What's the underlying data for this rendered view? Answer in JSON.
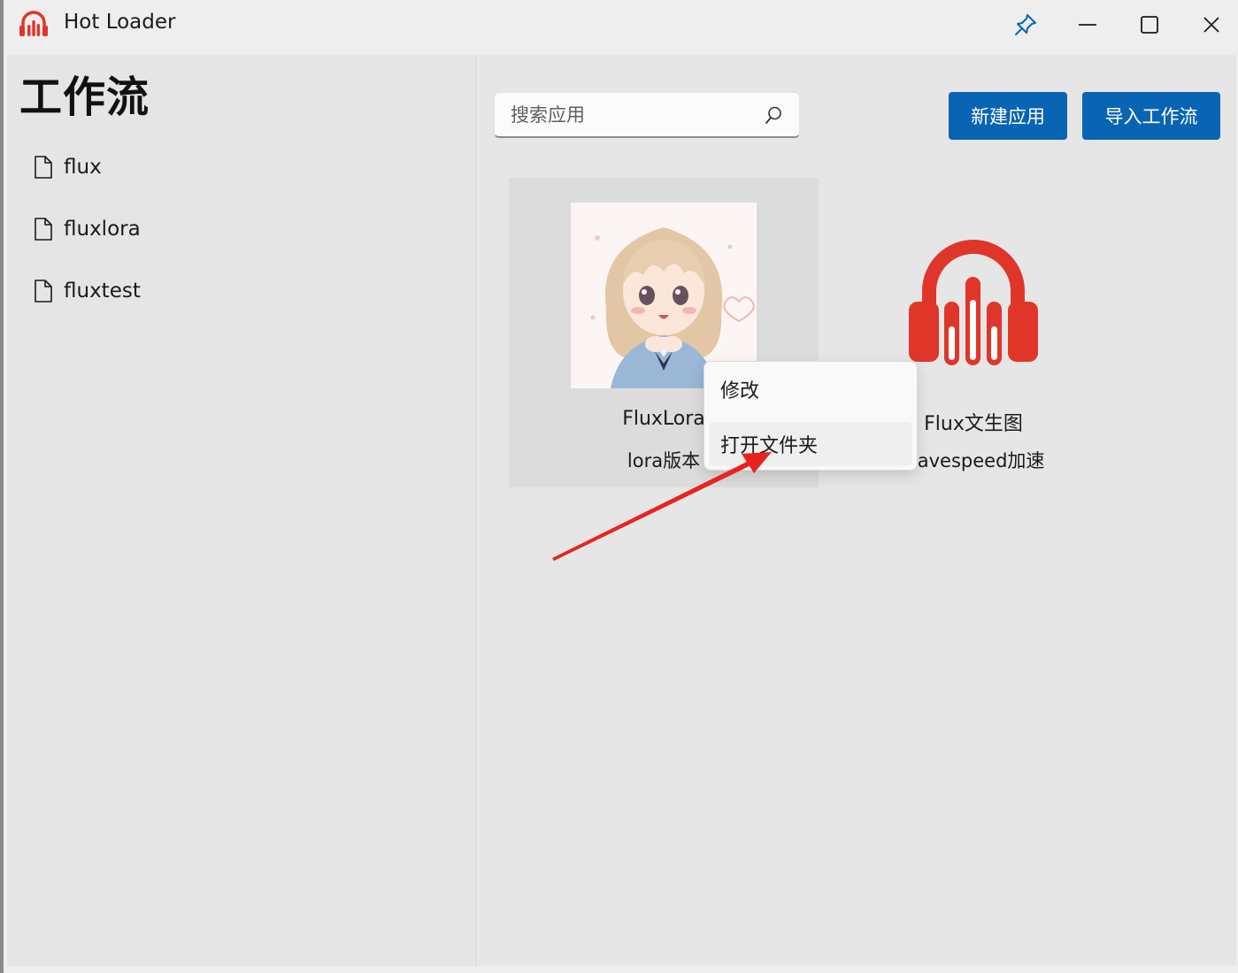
{
  "window": {
    "title": "Hot Loader",
    "icons": [
      "headphones-app-icon",
      "pin-icon",
      "minimize-icon",
      "maximize-icon",
      "close-icon"
    ]
  },
  "sidebar": {
    "title": "工作流",
    "items": [
      {
        "label": "flux",
        "icon": "document-icon"
      },
      {
        "label": "fluxlora",
        "icon": "document-icon"
      },
      {
        "label": "fluxtest",
        "icon": "document-icon"
      }
    ]
  },
  "toolbar": {
    "search_placeholder": "搜索应用",
    "new_app_label": "新建应用",
    "import_label": "导入工作流"
  },
  "apps": [
    {
      "title": "FluxLora",
      "subtitle": "lora版本",
      "image": "anime-character-thumbnail",
      "selected": true
    },
    {
      "title": "Flux文生图",
      "subtitle": "wavespeed加速",
      "image": "headphones-logo"
    }
  ],
  "context_menu": {
    "items": [
      {
        "label": "修改"
      },
      {
        "label": "打开文件夹",
        "highlighted": true
      }
    ]
  },
  "colors": {
    "accent": "#0a64b4",
    "logo_red": "#e0362a",
    "annotation_arrow": "#e8231e"
  }
}
